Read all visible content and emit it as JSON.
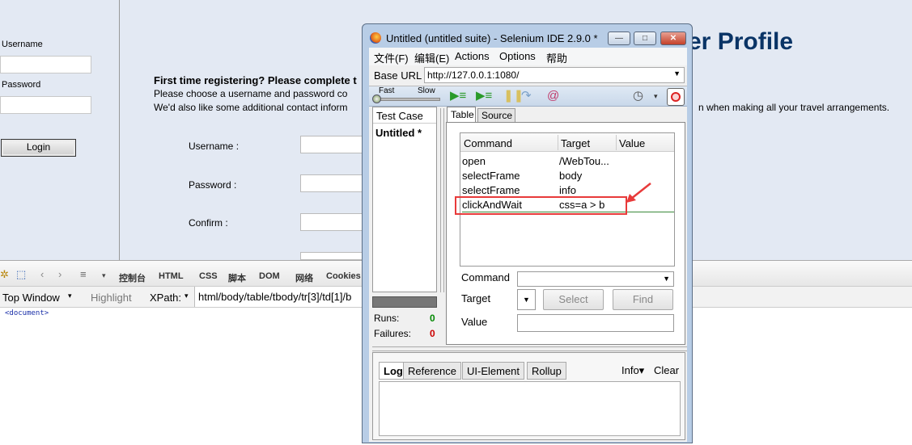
{
  "page": {
    "left_panel": {
      "username_label": "Username",
      "password_label": "Password",
      "login_button": "Login"
    },
    "profile_title": "er Profile",
    "registration": {
      "heading": "First time registering? Please complete t",
      "line1": "Please choose a username and password co",
      "line2": "We'd also like some additional contact inform",
      "line2_right": "n when making all your travel arrangements."
    },
    "form": {
      "username_label": "Username :",
      "password_label": "Password :",
      "confirm_label": "Confirm :"
    }
  },
  "firebug": {
    "tabs": [
      "控制台",
      "HTML",
      "CSS",
      "脚本",
      "DOM",
      "网络",
      "Cookies"
    ],
    "top_window": "Top Window",
    "highlight": "Highlight",
    "xpath_label": "XPath:",
    "xpath_value": "html/body/table/tbody/tr[3]/td[1]/b",
    "document_node": "<document>"
  },
  "ide": {
    "title": "Untitled (untitled suite) - Selenium IDE 2.9.0 *",
    "window_controls": {
      "minimize": "—",
      "maximize": "□",
      "close": "✕"
    },
    "menu": [
      "文件(F)",
      "编辑(E)",
      "Actions",
      "Options",
      "帮助"
    ],
    "base_url_label": "Base URL",
    "base_url_value": "http://127.0.0.1:1080/",
    "speed": {
      "fast": "Fast",
      "slow": "Slow"
    },
    "test_case": {
      "header": "Test Case",
      "item": "Untitled *"
    },
    "runs_label": "Runs:",
    "runs_value": "0",
    "failures_label": "Failures:",
    "failures_value": "0",
    "tabs": {
      "table": "Table",
      "source": "Source"
    },
    "columns": {
      "command": "Command",
      "target": "Target",
      "value": "Value"
    },
    "commands": [
      {
        "command": "open",
        "target": "/WebTou...",
        "value": ""
      },
      {
        "command": "selectFrame",
        "target": "body",
        "value": ""
      },
      {
        "command": "selectFrame",
        "target": "info",
        "value": ""
      },
      {
        "command": "clickAndWait",
        "target": "css=a > b",
        "value": ""
      }
    ],
    "fields": {
      "command_label": "Command",
      "target_label": "Target",
      "value_label": "Value",
      "select_button": "Select",
      "find_button": "Find"
    },
    "log": {
      "tabs": [
        "Log",
        "Reference",
        "UI-Element",
        "Rollup"
      ],
      "info": "Info▾",
      "clear": "Clear"
    },
    "colors": {
      "highlight_box": "#e83a3a",
      "runs_ok": "#008800",
      "failures": "#cc0000"
    }
  }
}
